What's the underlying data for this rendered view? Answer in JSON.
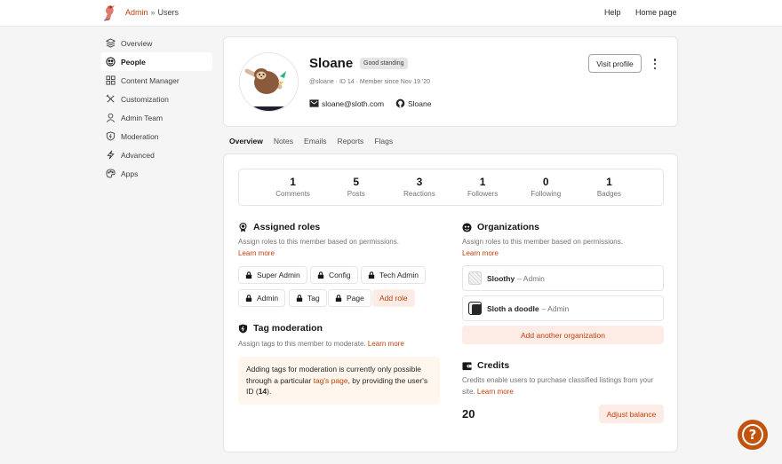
{
  "header": {
    "breadcrumb_root": "Admin",
    "breadcrumb_sep": "»",
    "breadcrumb_current": "Users",
    "nav": [
      {
        "label": "Help"
      },
      {
        "label": "Home page"
      }
    ]
  },
  "sidebar": {
    "items": [
      {
        "label": "Overview",
        "icon": "layers-icon"
      },
      {
        "label": "People",
        "icon": "people-icon",
        "active": true
      },
      {
        "label": "Content Manager",
        "icon": "grid-icon"
      },
      {
        "label": "Customization",
        "icon": "tools-icon"
      },
      {
        "label": "Admin Team",
        "icon": "user-icon"
      },
      {
        "label": "Moderation",
        "icon": "shield-icon"
      },
      {
        "label": "Advanced",
        "icon": "bolt-icon"
      },
      {
        "label": "Apps",
        "icon": "palette-icon"
      }
    ]
  },
  "profile": {
    "name": "Sloane",
    "badge": "Good standing",
    "meta": "@sloane · ID 14 · Member since Nov 19 '20",
    "email": "sloane@sloth.com",
    "github": "Sloane",
    "visit_label": "Visit profile"
  },
  "tabs": [
    {
      "label": "Overview",
      "active": true
    },
    {
      "label": "Notes"
    },
    {
      "label": "Emails"
    },
    {
      "label": "Reports"
    },
    {
      "label": "Flags"
    }
  ],
  "stats": [
    {
      "value": "1",
      "label": "Comments"
    },
    {
      "value": "5",
      "label": "Posts"
    },
    {
      "value": "3",
      "label": "Reactions"
    },
    {
      "value": "1",
      "label": "Followers"
    },
    {
      "value": "0",
      "label": "Following"
    },
    {
      "value": "1",
      "label": "Badges"
    }
  ],
  "roles": {
    "title": "Assigned roles",
    "desc": "Assign roles to this member based on permissions.",
    "learn_more": "Learn more",
    "items": [
      "Super Admin",
      "Config",
      "Tech Admin",
      "Admin",
      "Tag",
      "Page"
    ],
    "add_label": "Add role"
  },
  "tag_moderation": {
    "title": "Tag moderation",
    "desc": "Assign tags to this member to moderate.",
    "learn_more": "Learn more",
    "notice_pre": "Adding tags for moderation is currently only possible through a particular ",
    "notice_link": "tag's page",
    "notice_mid": ", by providing the user's ID (",
    "notice_id": "14",
    "notice_post": ")."
  },
  "organizations": {
    "title": "Organizations",
    "desc": "Assign roles to this member based on permissions.",
    "learn_more": "Learn more",
    "items": [
      {
        "name": "Sloothy",
        "role": "– Admin"
      },
      {
        "name": "Sloth a doodle",
        "role": "– Admin"
      }
    ],
    "add_label": "Add another organization"
  },
  "credits": {
    "title": "Credits",
    "desc": "Credits enable users to purchase classified listings from your site.",
    "learn_more": "Learn more",
    "value": "20",
    "adjust_label": "Adjust balance"
  },
  "help_fab": {
    "label": "?"
  },
  "colors": {
    "accent": "#c2410c",
    "accent_bg": "#fdece5",
    "notice_bg": "#fff7ed"
  }
}
